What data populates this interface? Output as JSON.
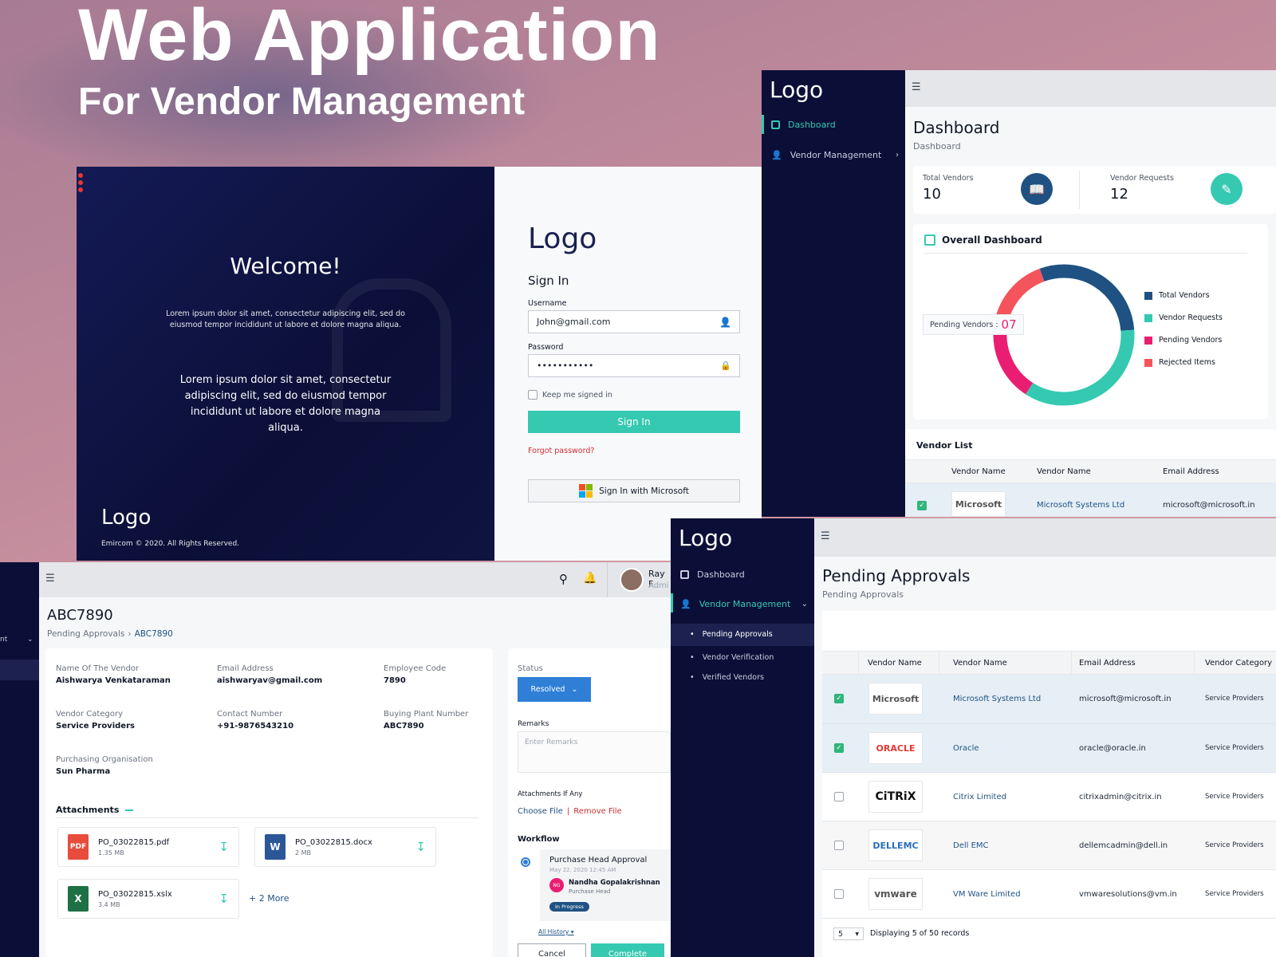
{
  "hero": {
    "title": "Web Application",
    "subtitle": "For Vendor Management"
  },
  "login": {
    "welcome": "Welcome!",
    "intro": "Lorem ipsum dolor sit amet, consectetur adipiscing elit, sed do eiusmod tempor incididunt ut labore et dolore magna aliqua.",
    "body": "Lorem ipsum dolor sit amet, consectetur adipiscing elit, sed do eiusmod tempor incididunt ut labore et dolore magna aliqua.",
    "left_logo": "Logo",
    "copyright": "Emircom © 2020. All Rights Reserved.",
    "logo": "Logo",
    "heading": "Sign In",
    "username_label": "Username",
    "username_value": "John@gmail.com",
    "password_label": "Password",
    "password_value": "•••••••••••",
    "keep_signed": "Keep me signed in",
    "signin": "Sign In",
    "forgot": "Forgot password?",
    "microsoft": "Sign In with Microsoft"
  },
  "dashboard": {
    "logo": "Logo",
    "nav": {
      "dashboard": "Dashboard",
      "vendor": "Vendor Management"
    },
    "title": "Dashboard",
    "breadcrumb": "Dashboard",
    "stats": [
      {
        "label": "Total Vendors",
        "value": "10"
      },
      {
        "label": "Vendor Requests",
        "value": "12"
      }
    ],
    "overall": "Overall Dashboard",
    "pending_label": "Pending Vendors :",
    "pending_value": "07",
    "vendor_list": "Vendor List",
    "list_cols": [
      "Vendor Name",
      "Vendor Name",
      "Email Address"
    ],
    "list_row": {
      "logo": "Microsoft",
      "name": "Microsoft Systems Ltd",
      "email": "microsoft@microsoft.in"
    }
  },
  "chart_data": {
    "type": "pie",
    "categories": [
      "Total Vendors",
      "Vendor Requests",
      "Pending Vendors",
      "Rejected Items"
    ],
    "values": [
      10,
      12,
      7,
      5
    ],
    "legend": "right",
    "colors": [
      "#1f5283",
      "#35c9b1",
      "#e91e72",
      "#f4545c"
    ]
  },
  "detail": {
    "title": "ABC7890",
    "crumb_parent": "Pending Approvals",
    "crumb_sep": "›",
    "crumb_current": "ABC7890",
    "fields": [
      {
        "label": "Name Of The Vendor",
        "value": "Aishwarya Venkataraman"
      },
      {
        "label": "Email Address",
        "value": "aishwaryav@gmail.com"
      },
      {
        "label": "Employee Code",
        "value": "7890"
      },
      {
        "label": "Vendor Category",
        "value": "Service Providers"
      },
      {
        "label": "Contact Number",
        "value": "+91-9876543210"
      },
      {
        "label": "Buying Plant Number",
        "value": "ABC7890"
      },
      {
        "label": "Purchasing Organisation",
        "value": "Sun Pharma"
      }
    ],
    "attachments": "Attachments",
    "files": [
      {
        "name": "PO_03022815.pdf",
        "size": "1.35 MB",
        "type": "PDF"
      },
      {
        "name": "PO_03022815.docx",
        "size": "2 MB",
        "type": "W"
      },
      {
        "name": "PO_03022815.xslx",
        "size": "3.4 MB",
        "type": "X"
      }
    ],
    "more": "+ 2 More",
    "user_name": "Ray F",
    "user_role": "Admi",
    "sidebar_label": "nt",
    "status_label": "Status",
    "status_value": "Resolved",
    "remarks_label": "Remarks",
    "remarks_placeholder": "Enter Remarks",
    "attach_label": "Attachments If Any",
    "choose": "Choose File",
    "remove": "Remove File",
    "workflow": "Workflow",
    "wf_title": "Purchase Head Approval",
    "wf_date": "May 22, 2020 12:45 AM",
    "wf_initials": "NG",
    "wf_name": "Nandha Gopalakrishnan",
    "wf_role": "Purchase Head",
    "wf_badge": "In Progress",
    "history": "All History",
    "cancel": "Cancel",
    "complete": "Complete"
  },
  "approvals": {
    "logo": "Logo",
    "nav": {
      "dashboard": "Dashboard",
      "vendor": "Vendor Management",
      "sub": [
        "Pending Approvals",
        "Vendor Verification",
        "Verified Vendors"
      ]
    },
    "title": "Pending Approvals",
    "breadcrumb": "Pending Approvals",
    "cols": [
      "Vendor Name",
      "Vendor Name",
      "Email Address",
      "Vendor Category"
    ],
    "rows": [
      {
        "logo": "Microsoft",
        "name": "Microsoft Systems Ltd",
        "email": "microsoft@microsoft.in",
        "category": "Service Providers",
        "checked": true
      },
      {
        "logo": "ORACLE",
        "name": "Oracle",
        "email": "oracle@oracle.in",
        "category": "Service Providers",
        "checked": true
      },
      {
        "logo": "CiTRiX",
        "name": "Citrix Limited",
        "email": "citrixadmin@citrix.in",
        "category": "Service Providers",
        "checked": false
      },
      {
        "logo": "DELLEMC",
        "name": "Dell EMC",
        "email": "dellemcadmin@dell.in",
        "category": "Service Providers",
        "checked": false
      },
      {
        "logo": "vmware",
        "name": "VM Ware Limited",
        "email": "vmwaresolutions@vm.in",
        "category": "Service Providers",
        "checked": false
      }
    ],
    "page_size": "5",
    "records": "Displaying 5 of 50 records"
  }
}
